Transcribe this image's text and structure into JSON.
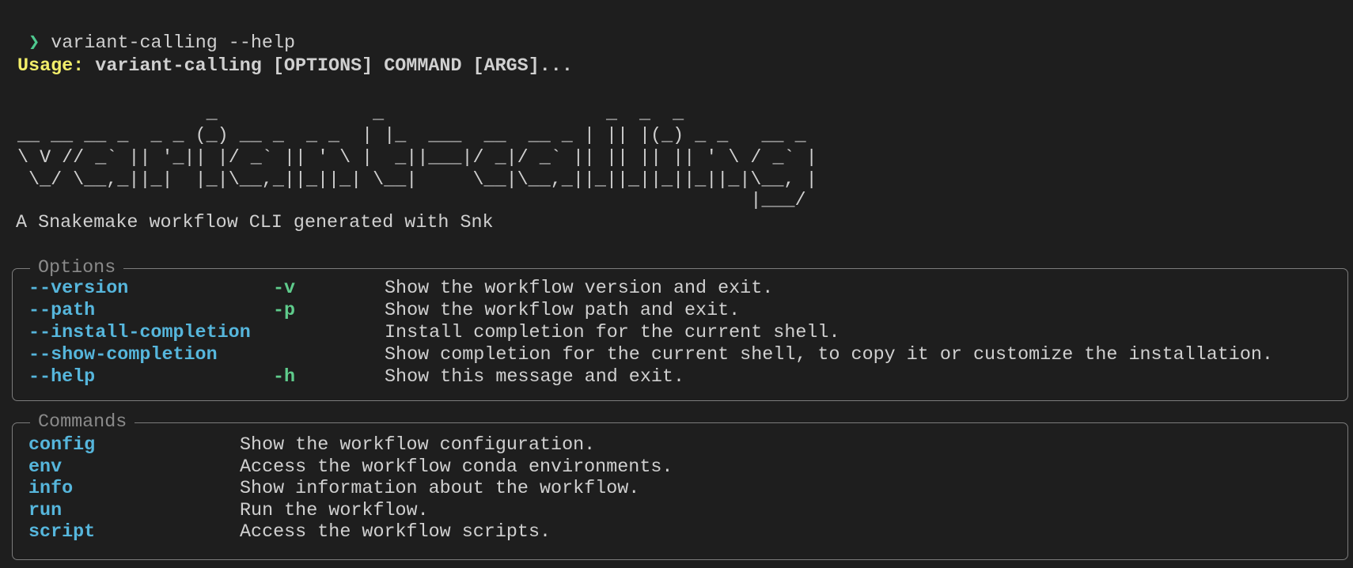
{
  "terminal": {
    "prompt_symbol": "❯",
    "command": "variant-calling --help",
    "usage_label": "Usage:",
    "usage_text": "variant-calling [OPTIONS] COMMAND [ARGS]...",
    "banner": [
      "                 _              _                    _  _  _",
      "__ __ __ _  _ _ (_) __ _  _ _  | |_  ___  __  __ _ | || |(_) _ _   __ _",
      "\\ V // _` || '_|| |/ _` || ' \\ |  _||___|/ _|/ _` || || || || ' \\ / _` |",
      " \\_/ \\__,_||_|  |_|\\__,_||_||_| \\__|     \\__|\\__,_||_||_||_||_||_|\\__, |",
      "                                                                  |___/"
    ],
    "tagline": "A Snakemake workflow CLI generated with Snk"
  },
  "options": {
    "title": "Options",
    "items": [
      {
        "flag": "--version",
        "short": "-v",
        "description": "Show the workflow version and exit."
      },
      {
        "flag": "--path",
        "short": "-p",
        "description": "Show the workflow path and exit."
      },
      {
        "flag": "--install-completion",
        "short": "",
        "description": "Install completion for the current shell."
      },
      {
        "flag": "--show-completion",
        "short": "",
        "description": "Show completion for the current shell, to copy it or customize the installation."
      },
      {
        "flag": "--help",
        "short": "-h",
        "description": "Show this message and exit."
      }
    ]
  },
  "commands": {
    "title": "Commands",
    "items": [
      {
        "name": "config",
        "description": "Show the workflow configuration."
      },
      {
        "name": "env",
        "description": "Access the workflow conda environments."
      },
      {
        "name": "info",
        "description": "Show information about the workflow."
      },
      {
        "name": "run",
        "description": "Run the workflow."
      },
      {
        "name": "script",
        "description": "Access the workflow scripts."
      }
    ]
  },
  "colors": {
    "background": "#1e1e1e",
    "prompt": "#4ec98f",
    "usage": "#f2ee6a",
    "flag": "#56b6dc",
    "short_flag": "#5fcc8c",
    "border": "#7c7c7c"
  }
}
